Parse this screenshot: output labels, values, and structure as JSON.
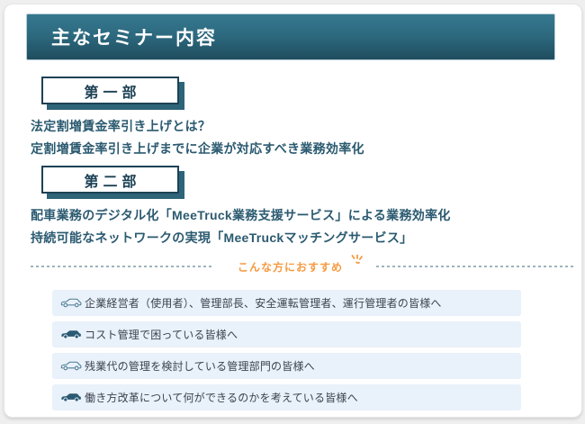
{
  "page": {
    "title": "主なセミナー内容"
  },
  "sections": [
    {
      "badge": "第一部",
      "lines": [
        "法定割増賃金率引き上げとは？",
        "定割増賃金率引き上げまでに企業が対応すべき業務効率化"
      ]
    },
    {
      "badge": "第二部",
      "lines": [
        "配車業務のデジタル化「MeeTruck業務支援サービス」による業務効率化",
        "持続可能なネットワークの実現「MeeTruckマッチングサービス」"
      ]
    }
  ],
  "recommend": {
    "heading": "こんな方におすすめ",
    "sparkle_icon": "sparkle-icon",
    "items": [
      {
        "icon": "car-outline-icon",
        "label": "企業経営者（使用者）、管理部長、安全運転管理者、運行管理者の皆様へ"
      },
      {
        "icon": "car-filled-icon",
        "label": "コスト管理で困っている皆様へ"
      },
      {
        "icon": "car-outline-icon",
        "label": "残業代の管理を検討している管理部門の皆様へ"
      },
      {
        "icon": "car-filled-icon",
        "label": "働き方改革について何ができるのかを考えている皆様へ"
      }
    ]
  },
  "colors": {
    "banner_top": "#36788e",
    "banner_bottom": "#204d5e",
    "accent_teal": "#2b5a70",
    "badge_border": "#1d4255",
    "badge_shadow": "#2e6478",
    "orange": "#f59b42",
    "list_bg": "#e9f1fa",
    "list_text": "#3b4350",
    "dash": "#9fb3bb",
    "car_outline": "#4e7d95",
    "car_filled": "#2b5a73"
  }
}
